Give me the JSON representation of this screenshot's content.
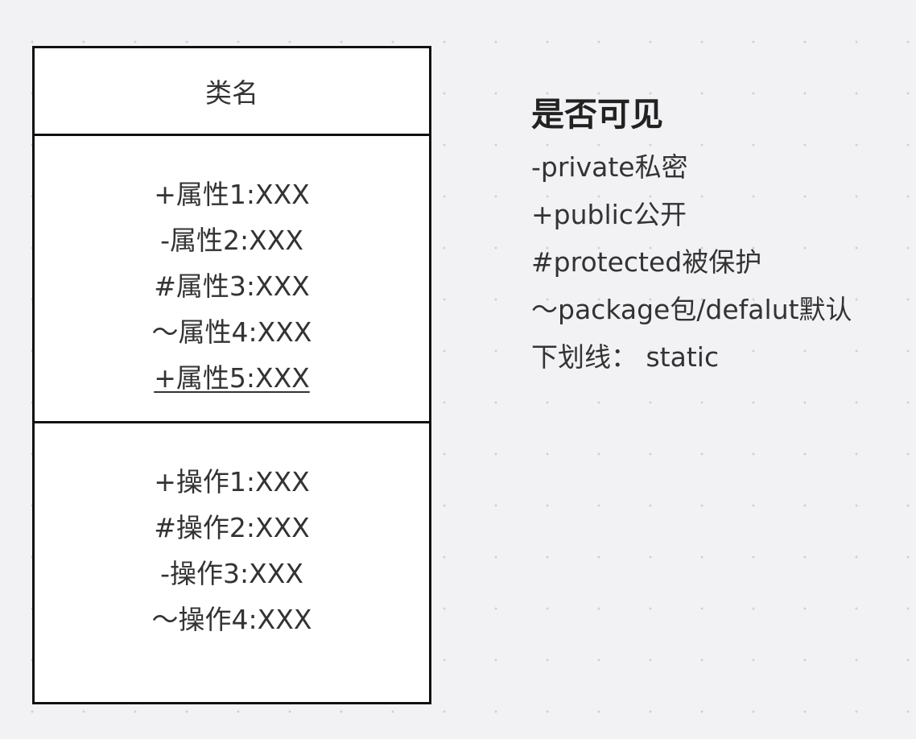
{
  "class_box": {
    "name": "类名",
    "attributes": [
      {
        "text": "+属性1:XXX",
        "static": false
      },
      {
        "text": "-属性2:XXX",
        "static": false
      },
      {
        "text": "#属性3:XXX",
        "static": false
      },
      {
        "text": "～属性4:XXX",
        "static": false
      },
      {
        "text": "+属性5:XXX",
        "static": true
      }
    ],
    "operations": [
      {
        "text": "+操作1:XXX"
      },
      {
        "text": "#操作2:XXX"
      },
      {
        "text": "-操作3:XXX"
      },
      {
        "text": "～操作4:XXX"
      }
    ]
  },
  "legend": {
    "title": "是否可见",
    "items": [
      "-private私密",
      "+public公开",
      "#protected被保护",
      "～package包/defalut默认",
      "下划线： static"
    ]
  },
  "colors": {
    "background": "#f2f2f5",
    "border": "#111111",
    "text": "#333333"
  }
}
